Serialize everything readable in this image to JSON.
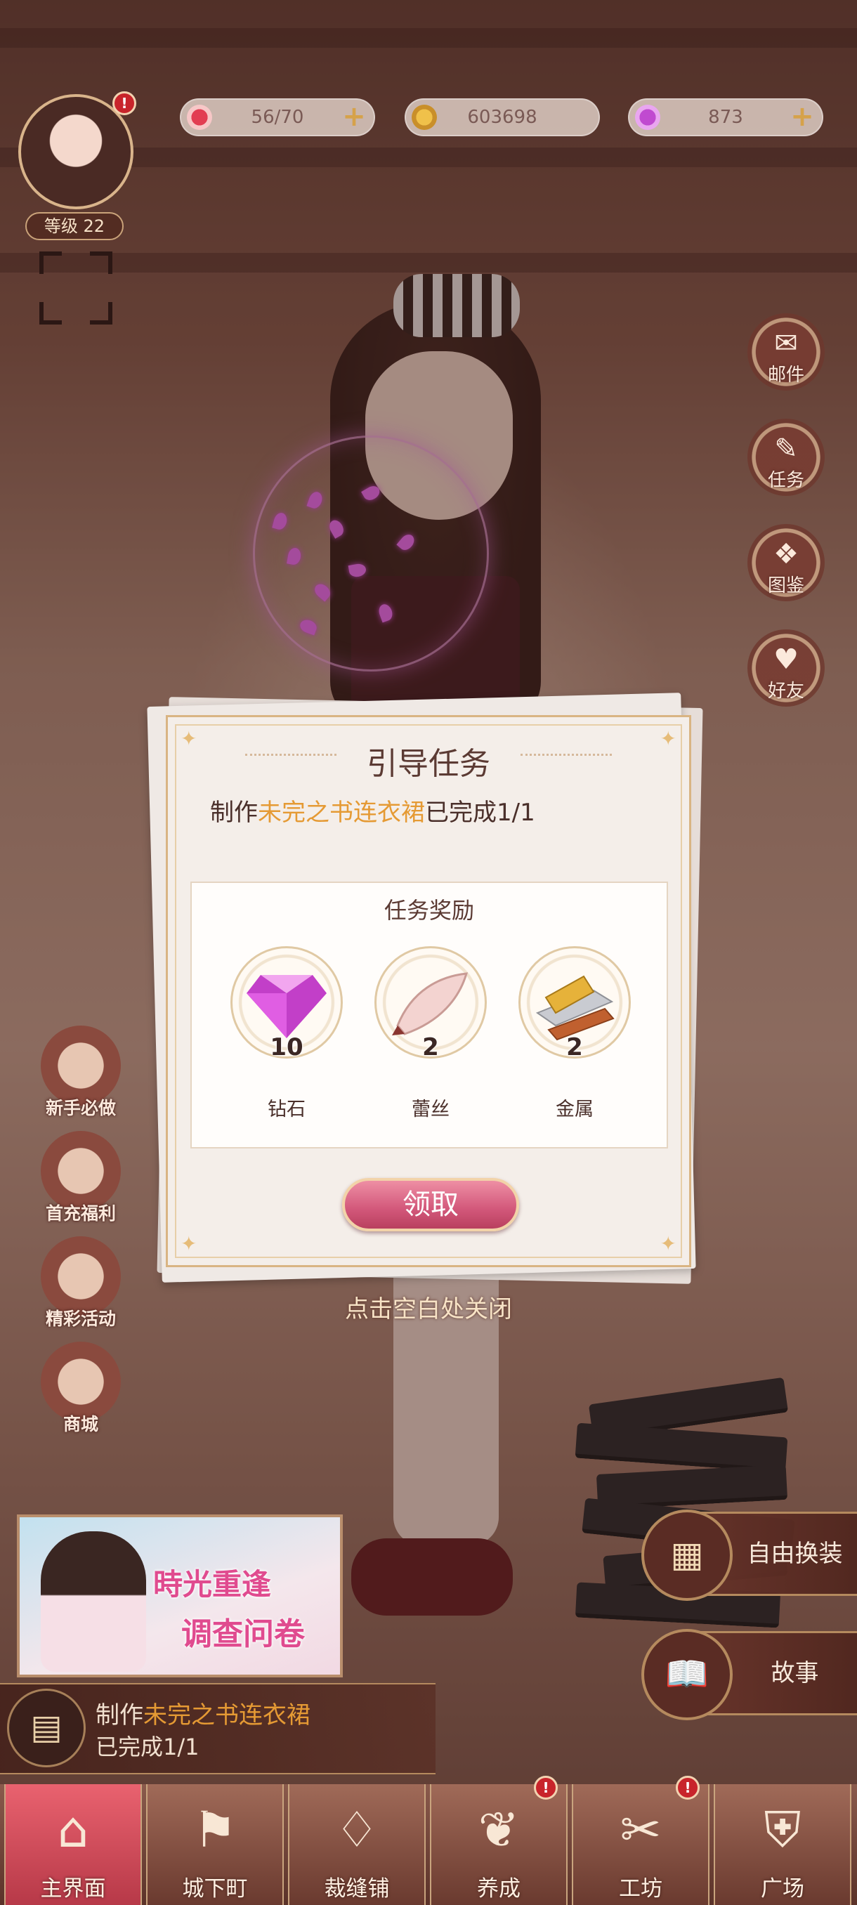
{
  "hud": {
    "level": "等级 22",
    "stamina": "56/70",
    "gold": "603698",
    "diamonds": "873",
    "plus": "+",
    "alert": "!"
  },
  "side_menu": [
    {
      "label": "邮件",
      "icon": "mail-icon"
    },
    {
      "label": "任务",
      "icon": "task-icon"
    },
    {
      "label": "图鉴",
      "icon": "collection-icon"
    },
    {
      "label": "好友",
      "icon": "friends-icon"
    }
  ],
  "left_menu": [
    {
      "label": "新手必做",
      "icon": "beginner-icon"
    },
    {
      "label": "首充福利",
      "icon": "first-charge-icon"
    },
    {
      "label": "精彩活动",
      "icon": "events-icon"
    },
    {
      "label": "商城",
      "icon": "shop-icon"
    }
  ],
  "dialog": {
    "title": "引导任务",
    "task_prefix": "制作",
    "task_item": "未完之书连衣裙",
    "task_suffix": "已完成1/1",
    "rewards_title": "任务奖励",
    "rewards": [
      {
        "name": "钻石",
        "count": "10",
        "icon": "diamond-icon"
      },
      {
        "name": "蕾丝",
        "count": "2",
        "icon": "lace-icon"
      },
      {
        "name": "金属",
        "count": "2",
        "icon": "metal-icon"
      }
    ],
    "claim_label": "领取",
    "close_hint": "点击空白处关闭"
  },
  "banner": {
    "line1": "時光重逢",
    "line2": "调查问卷"
  },
  "task_bar": {
    "prefix": "制作",
    "item": "未完之书连衣裙",
    "progress": "已完成1/1"
  },
  "right_buttons": [
    {
      "label": "自由换装",
      "icon": "dresser-icon"
    },
    {
      "label": "故事",
      "icon": "story-book-icon"
    }
  ],
  "bottom_nav": [
    {
      "label": "主界面",
      "icon": "home-icon",
      "active": true
    },
    {
      "label": "城下町",
      "icon": "town-flag-icon"
    },
    {
      "label": "裁缝铺",
      "icon": "dress-icon"
    },
    {
      "label": "养成",
      "icon": "growth-icon",
      "alert": true
    },
    {
      "label": "工坊",
      "icon": "workshop-icon",
      "alert": true
    },
    {
      "label": "广场",
      "icon": "plaza-icon"
    }
  ],
  "colors": {
    "accent": "#e59a34",
    "claim": "#d2577a",
    "nav_active": "#e9626f"
  }
}
